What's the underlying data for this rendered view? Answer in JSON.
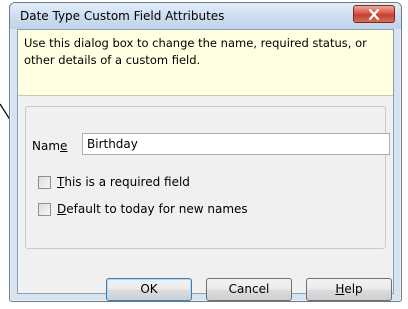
{
  "dialog": {
    "title": "Date Type Custom Field Attributes",
    "info_text": "Use this dialog box to change the name, required status, or other details of a custom field.",
    "name_label_pre": "Nam",
    "name_label_accel": "e",
    "name_value": "Birthday",
    "required_checkbox": {
      "accel": "T",
      "rest": "his is a required field",
      "checked": false
    },
    "default_today_checkbox": {
      "accel": "D",
      "rest": "efault to today for new names",
      "checked": false
    },
    "buttons": {
      "ok": "OK",
      "cancel": "Cancel",
      "help_accel": "H",
      "help_rest": "elp"
    }
  },
  "icons": {
    "close": "close-icon",
    "pointer": "arrow-pointer-icon"
  }
}
